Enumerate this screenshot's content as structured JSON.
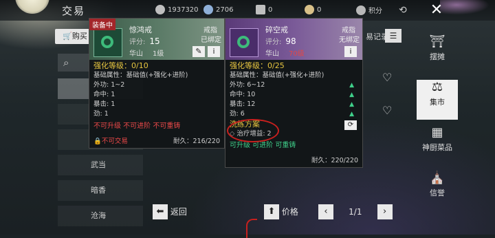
{
  "header": {
    "title": "交易",
    "currencies": [
      {
        "icon": "coin-icon",
        "value": "1937320"
      },
      {
        "icon": "gem-icon",
        "value": "2706"
      },
      {
        "icon": "ticket-icon",
        "value": "0"
      },
      {
        "icon": "ingot-icon",
        "value": "0"
      }
    ],
    "points_label": "积分"
  },
  "left": {
    "buy_label": "购买",
    "categories": [
      "武当",
      "暗香",
      "沧海"
    ]
  },
  "list": {
    "record_label": "易记录"
  },
  "right_nav": [
    {
      "label": "摆摊",
      "icon": "stall-icon"
    },
    {
      "label": "集市",
      "icon": "market-icon"
    },
    {
      "label": "神厨菜品",
      "icon": "chef-icon"
    },
    {
      "label": "信誉",
      "icon": "reputation-icon"
    }
  ],
  "bottom": {
    "back_label": "返回",
    "sort_label": "价格",
    "page": "1/1"
  },
  "card_equipped": {
    "tag": "装备中",
    "name": "惊鸿戒",
    "slot": "戒指",
    "score_label": "评分:",
    "score": "15",
    "bind": "已绑定",
    "sect": "华山",
    "level": "1级",
    "enhance": "强化等级：0/10",
    "base_attr": "基础属性：基础值(+强化+进阶)",
    "stats": [
      "外功: 1~2",
      "命中: 1",
      "暴击: 1",
      "劲: 1"
    ],
    "restrictions": "不可升级 不可进阶 不可重铸",
    "trade": "不可交易",
    "durability": "耐久：216/220"
  },
  "card_compare": {
    "name": "碎空戒",
    "slot": "戒指",
    "score_label": "评分:",
    "score": "98",
    "bind": "无绑定",
    "sect": "华山",
    "level": "70级",
    "enhance": "强化等级：0/25",
    "base_attr": "基础属性：基础值(+强化+进阶)",
    "stats": [
      "外功: 6~12",
      "命中: 10",
      "暴击: 12",
      "劲: 6"
    ],
    "refine_title": "洗练方案",
    "refine_stat": "治疗增益: 2",
    "abilities": "可升级 可进阶 可重铸",
    "durability": "耐久：220/220"
  },
  "colors": {
    "red_text": "#e84848",
    "green_text": "#3fd08a",
    "yellow_text": "#e8c640",
    "annotation": "#c8201e"
  }
}
